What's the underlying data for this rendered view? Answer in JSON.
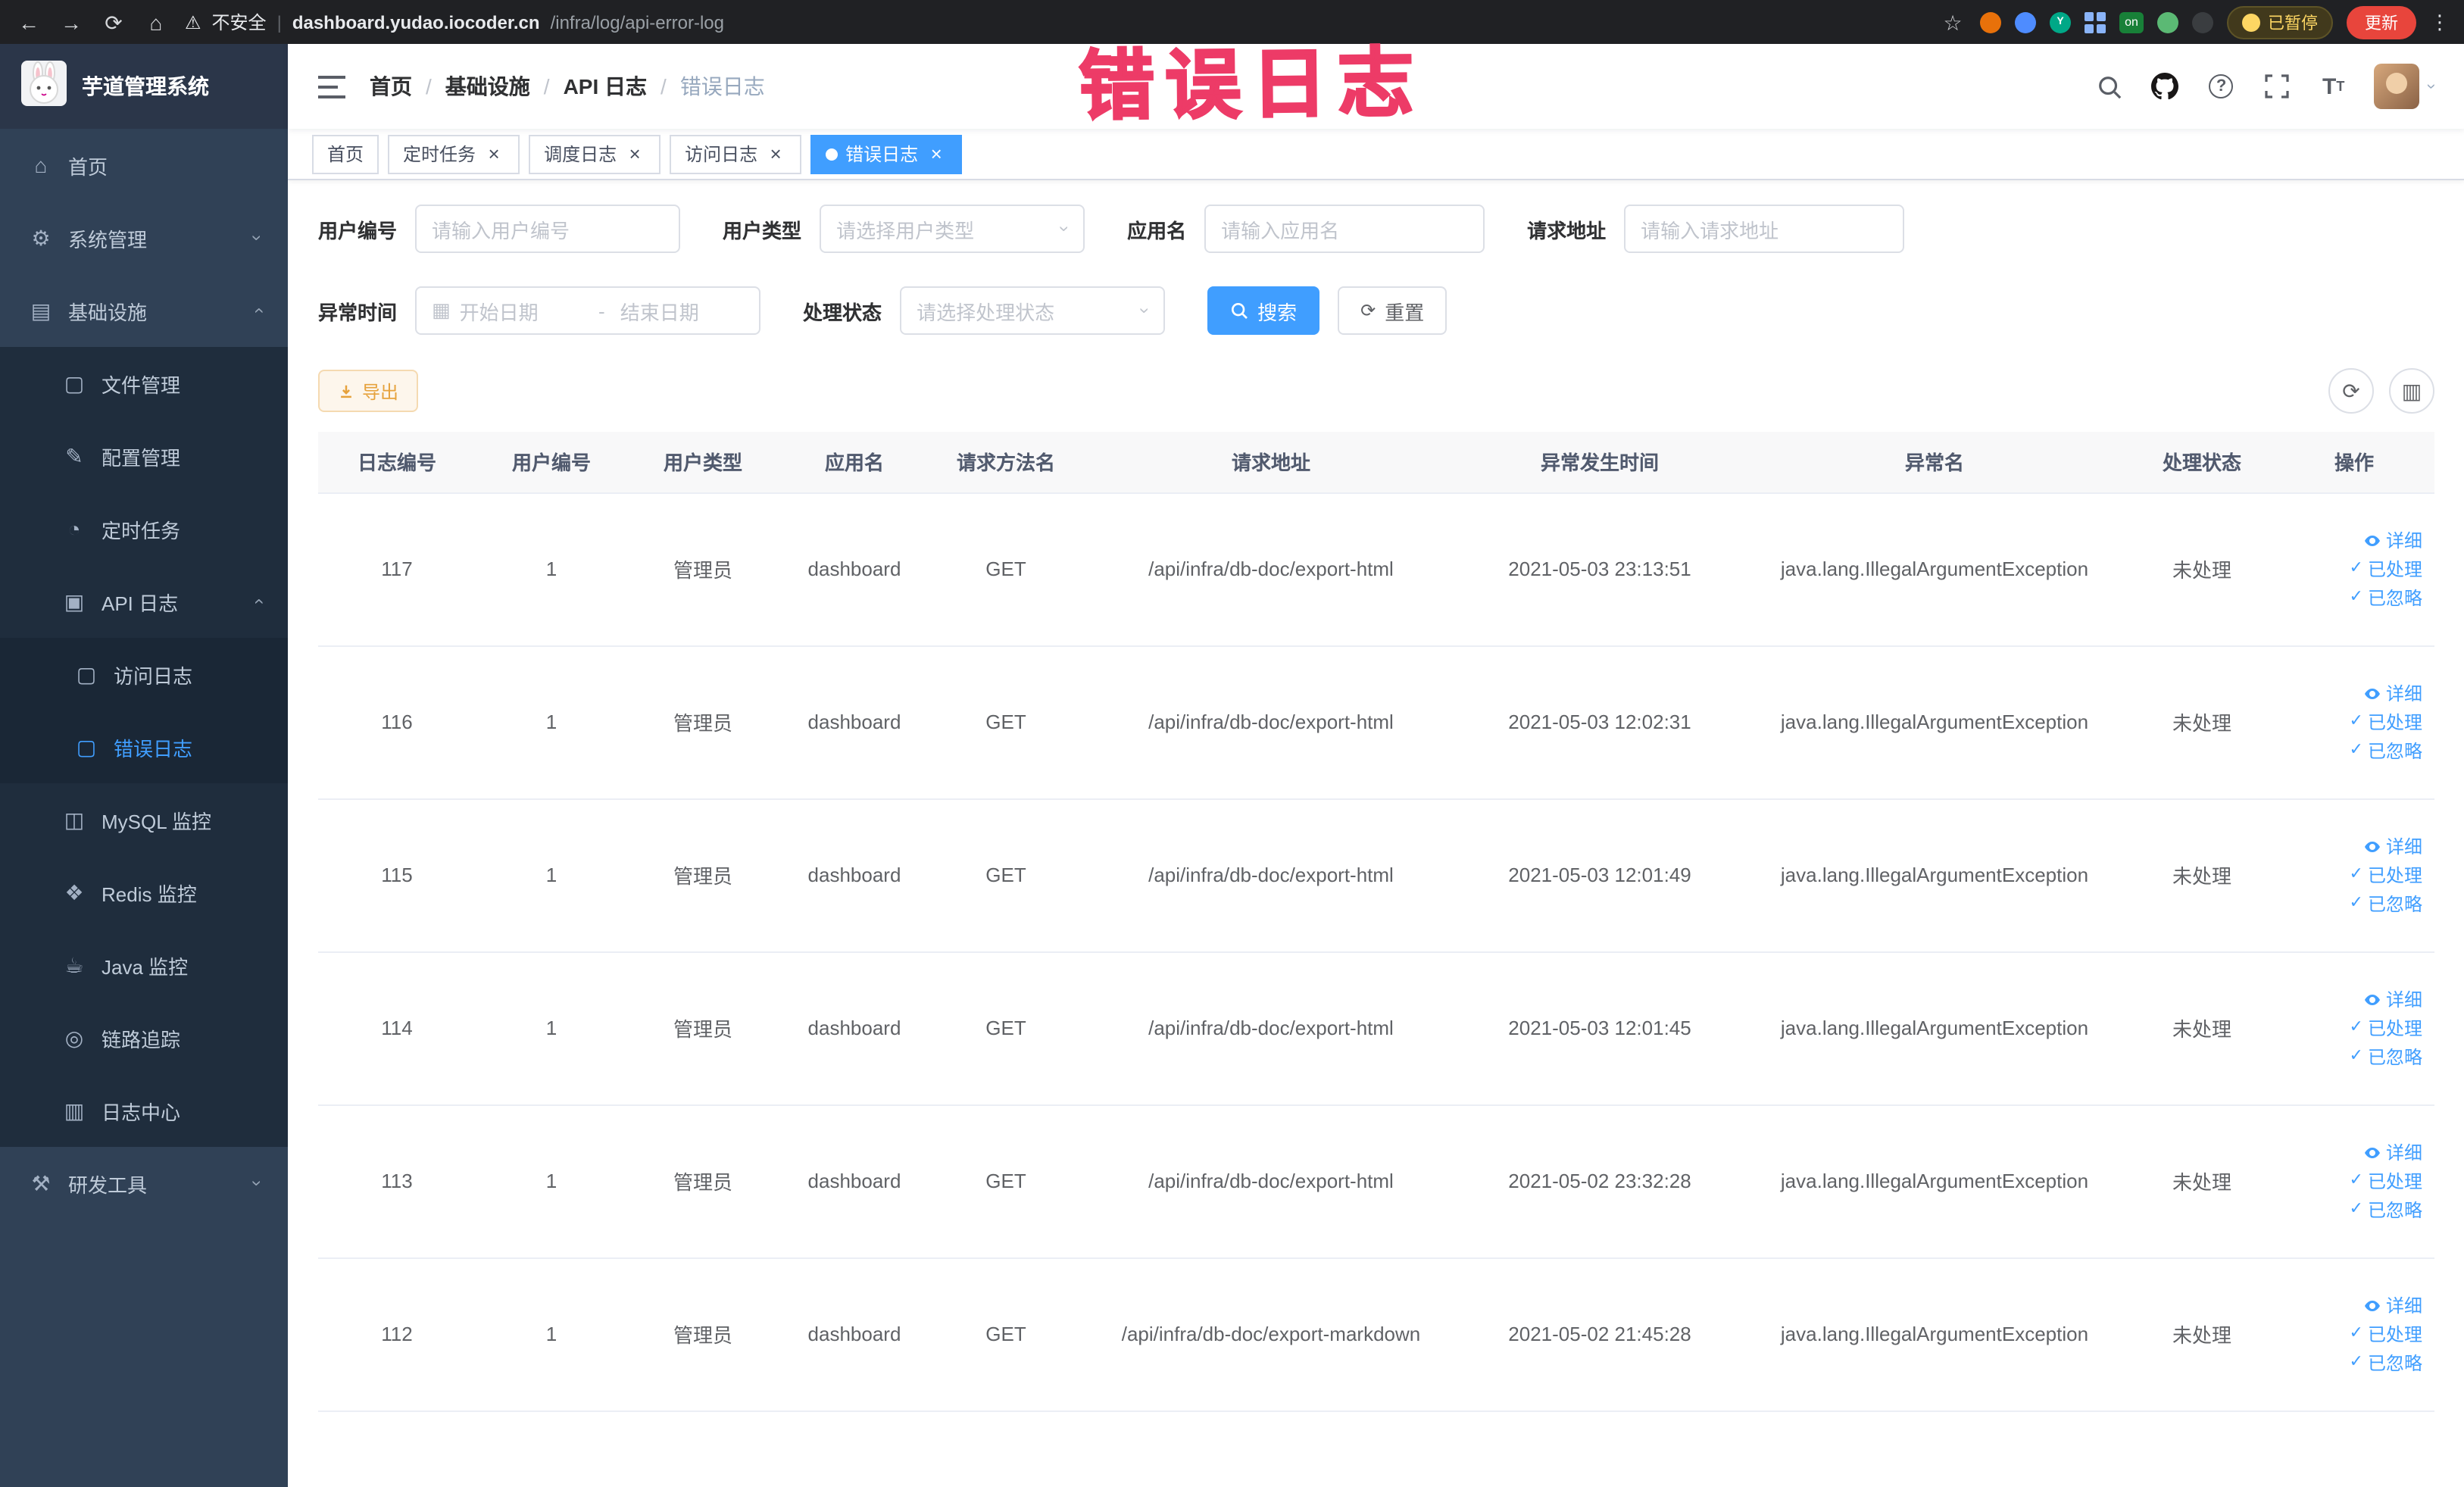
{
  "browser": {
    "security_label": "不安全",
    "url_host": "dashboard.yudao.iocoder.cn",
    "url_path": "/infra/log/api-error-log",
    "paused_badge": "已暂停",
    "update_label": "更新",
    "on_badge": "on"
  },
  "annotation": {
    "text": "错误日志"
  },
  "sidebar": {
    "logo_title": "芋道管理系统",
    "items": [
      {
        "label": "首页",
        "icon": "home-icon",
        "level": 1
      },
      {
        "label": "系统管理",
        "icon": "gear-icon",
        "level": 1,
        "arrow": "down"
      },
      {
        "label": "基础设施",
        "icon": "infra-icon",
        "level": 1,
        "arrow": "up"
      },
      {
        "label": "文件管理",
        "icon": "file-icon",
        "level": 2
      },
      {
        "label": "配置管理",
        "icon": "config-icon",
        "level": 2
      },
      {
        "label": "定时任务",
        "icon": "timer-icon",
        "level": 2
      },
      {
        "label": "API 日志",
        "icon": "api-log-icon",
        "level": 2,
        "arrow": "up"
      },
      {
        "label": "访问日志",
        "icon": "access-log-icon",
        "level": 3
      },
      {
        "label": "错误日志",
        "icon": "error-log-icon",
        "level": 3,
        "active": true
      },
      {
        "label": "MySQL 监控",
        "icon": "mysql-icon",
        "level": 2
      },
      {
        "label": "Redis 监控",
        "icon": "redis-icon",
        "level": 2
      },
      {
        "label": "Java 监控",
        "icon": "java-icon",
        "level": 2
      },
      {
        "label": "链路追踪",
        "icon": "trace-icon",
        "level": 2
      },
      {
        "label": "日志中心",
        "icon": "log-center-icon",
        "level": 2
      },
      {
        "label": "研发工具",
        "icon": "tools-icon",
        "level": 1,
        "arrow": "down"
      }
    ]
  },
  "header": {
    "breadcrumb": [
      "首页",
      "基础设施",
      "API 日志",
      "错误日志"
    ]
  },
  "tabs": [
    {
      "label": "首页",
      "closable": false,
      "active": false
    },
    {
      "label": "定时任务",
      "closable": true,
      "active": false
    },
    {
      "label": "调度日志",
      "closable": true,
      "active": false
    },
    {
      "label": "访问日志",
      "closable": true,
      "active": false
    },
    {
      "label": "错误日志",
      "closable": true,
      "active": true
    }
  ],
  "filters": {
    "user_id": {
      "label": "用户编号",
      "placeholder": "请输入用户编号"
    },
    "user_type": {
      "label": "用户类型",
      "placeholder": "请选择用户类型"
    },
    "app_name": {
      "label": "应用名",
      "placeholder": "请输入应用名"
    },
    "request_url": {
      "label": "请求地址",
      "placeholder": "请输入请求地址"
    },
    "exception_time": {
      "label": "异常时间",
      "start_placeholder": "开始日期",
      "separator": "-",
      "end_placeholder": "结束日期"
    },
    "process_status": {
      "label": "处理状态",
      "placeholder": "请选择处理状态"
    },
    "search_label": "搜索",
    "reset_label": "重置"
  },
  "toolbar": {
    "export_label": "导出"
  },
  "table": {
    "columns": [
      "日志编号",
      "用户编号",
      "用户类型",
      "应用名",
      "请求方法名",
      "请求地址",
      "异常发生时间",
      "异常名",
      "处理状态",
      "操作"
    ],
    "action_labels": [
      "详细",
      "已处理",
      "已忽略"
    ],
    "rows": [
      {
        "log_id": "117",
        "user_id": "1",
        "user_type": "管理员",
        "app_name": "dashboard",
        "method": "GET",
        "request_url": "/api/infra/db-doc/export-html",
        "time": "2021-05-03 23:13:51",
        "exception": "java.lang.IllegalArgumentException",
        "status": "未处理"
      },
      {
        "log_id": "116",
        "user_id": "1",
        "user_type": "管理员",
        "app_name": "dashboard",
        "method": "GET",
        "request_url": "/api/infra/db-doc/export-html",
        "time": "2021-05-03 12:02:31",
        "exception": "java.lang.IllegalArgumentException",
        "status": "未处理"
      },
      {
        "log_id": "115",
        "user_id": "1",
        "user_type": "管理员",
        "app_name": "dashboard",
        "method": "GET",
        "request_url": "/api/infra/db-doc/export-html",
        "time": "2021-05-03 12:01:49",
        "exception": "java.lang.IllegalArgumentException",
        "status": "未处理"
      },
      {
        "log_id": "114",
        "user_id": "1",
        "user_type": "管理员",
        "app_name": "dashboard",
        "method": "GET",
        "request_url": "/api/infra/db-doc/export-html",
        "time": "2021-05-03 12:01:45",
        "exception": "java.lang.IllegalArgumentException",
        "status": "未处理"
      },
      {
        "log_id": "113",
        "user_id": "1",
        "user_type": "管理员",
        "app_name": "dashboard",
        "method": "GET",
        "request_url": "/api/infra/db-doc/export-html",
        "time": "2021-05-02 23:32:28",
        "exception": "java.lang.IllegalArgumentException",
        "status": "未处理"
      },
      {
        "log_id": "112",
        "user_id": "1",
        "user_type": "管理员",
        "app_name": "dashboard",
        "method": "GET",
        "request_url": "/api/infra/db-doc/export-markdown",
        "time": "2021-05-02 21:45:28",
        "exception": "java.lang.IllegalArgumentException",
        "status": "未处理"
      }
    ]
  },
  "colors": {
    "primary": "#409eff",
    "annotation": "#ed3b67",
    "warning": "#e6a23c",
    "sidebar_bg": "#304156"
  }
}
